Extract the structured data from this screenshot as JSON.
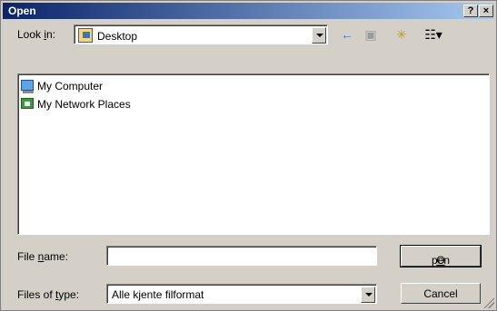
{
  "window": {
    "title": "Open",
    "help_label": "?",
    "close_label": "×"
  },
  "lookin": {
    "label_pre": "Look ",
    "label_u": "i",
    "label_post": "n:",
    "value": "Desktop",
    "icon": "desktop-icon"
  },
  "toolbar": {
    "back_icon": "←",
    "up_icon": "▣",
    "new_folder_icon": "✳",
    "views_icon": "☷▾"
  },
  "files": [
    {
      "label": "My Computer",
      "icon": "computer-icon"
    },
    {
      "label": "My Network Places",
      "icon": "network-places-icon"
    }
  ],
  "filename": {
    "label_pre": "File ",
    "label_u": "n",
    "label_post": "ame:",
    "value": ""
  },
  "filetype": {
    "label_pre": "Files of ",
    "label_u": "t",
    "label_post": "ype:",
    "value": "Alle kjente filformat"
  },
  "buttons": {
    "open_u": "O",
    "open_rest": "pen",
    "cancel": "Cancel"
  }
}
